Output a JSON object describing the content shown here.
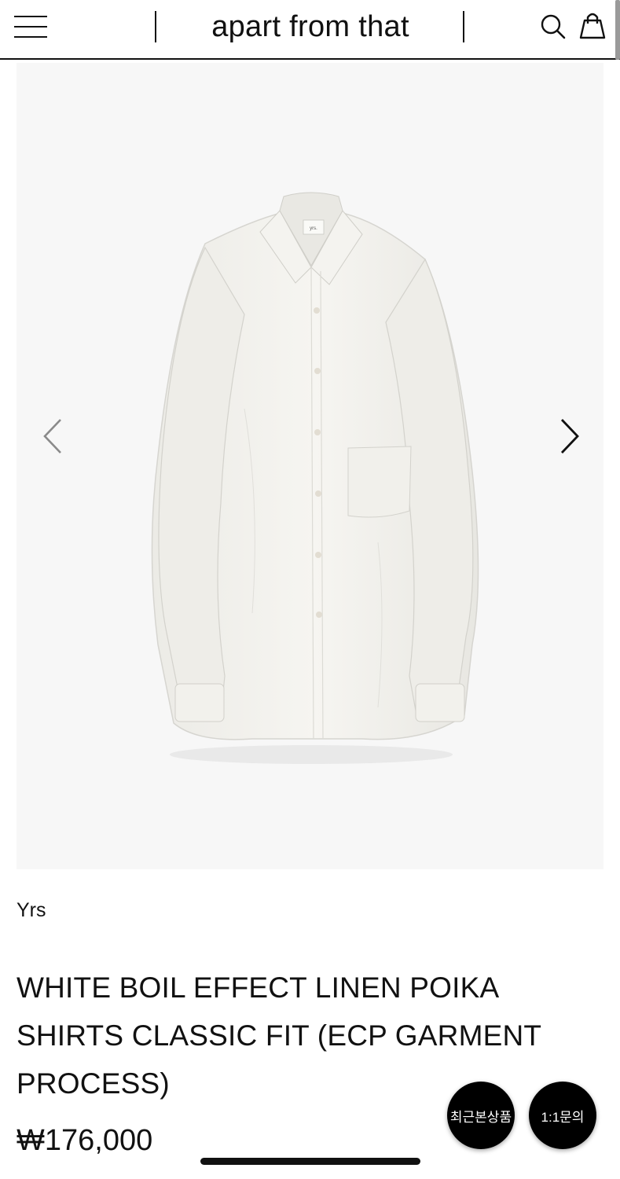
{
  "header": {
    "logo_text": "apart from that",
    "menu_icon": "hamburger-menu-icon",
    "search_icon": "search-icon",
    "cart_icon": "shopping-bag-icon"
  },
  "gallery": {
    "prev_icon": "chevron-left-icon",
    "next_icon": "chevron-right-icon",
    "image_label": "yrs.",
    "background_color": "#f7f7f7"
  },
  "product": {
    "brand": "Yrs",
    "title": "WHITE BOIL EFFECT LINEN POIKA SHIRTS CLASSIC FIT (ECP GARMENT PROCESS)",
    "price": "₩176,000"
  },
  "floating": {
    "recent_label": "최근본상품",
    "inquiry_label": "1:1문의"
  }
}
